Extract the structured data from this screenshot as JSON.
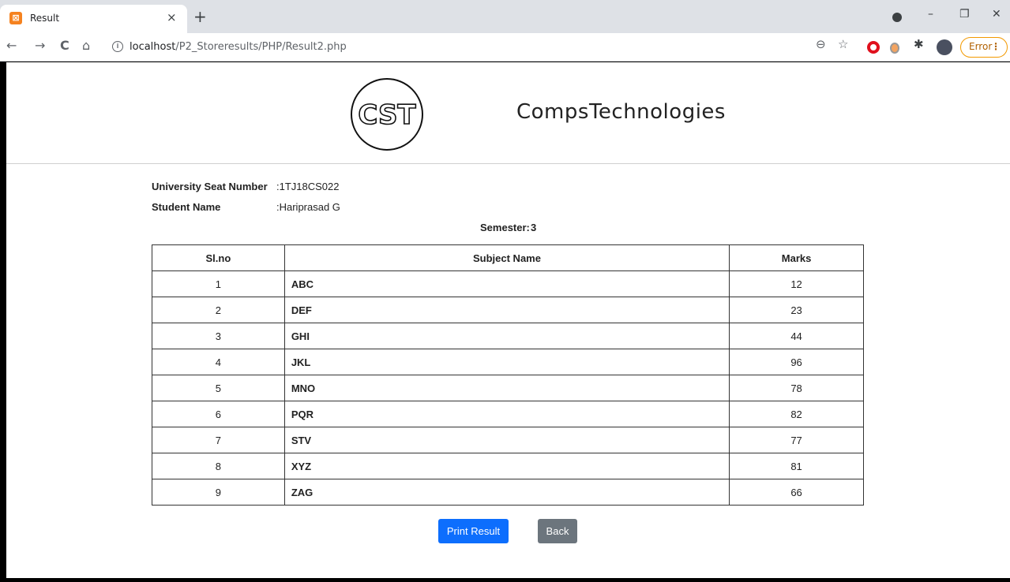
{
  "browser": {
    "tab_title": "Result",
    "tab_close": "×",
    "new_tab": "+",
    "url_host": "localhost",
    "url_path": "/P2_Storeresults/PHP/Result2.php",
    "error_label": "Error",
    "error_menu": "⋮",
    "minimize": "–",
    "restore": "❐",
    "close": "✕",
    "back": "←",
    "forward": "→",
    "reload": "C",
    "home": "⌂",
    "zoom": "⊖",
    "star": "☆",
    "info": "i"
  },
  "brand": {
    "logo_text": "CST",
    "name": "CompsTechnologies"
  },
  "student": {
    "usn_label": "University Seat Number",
    "usn_value": ":1TJ18CS022",
    "name_label": "Student Name",
    "name_value": ":Hariprasad G",
    "semester_label": "Semester:",
    "semester_value": "3"
  },
  "table": {
    "headers": [
      "Sl.no",
      "Subject Name",
      "Marks"
    ],
    "rows": [
      [
        "1",
        "ABC",
        "12"
      ],
      [
        "2",
        "DEF",
        "23"
      ],
      [
        "3",
        "GHI",
        "44"
      ],
      [
        "4",
        "JKL",
        "96"
      ],
      [
        "5",
        "MNO",
        "78"
      ],
      [
        "6",
        "PQR",
        "82"
      ],
      [
        "7",
        "STV",
        "77"
      ],
      [
        "8",
        "XYZ",
        "81"
      ],
      [
        "9",
        "ZAG",
        "66"
      ]
    ]
  },
  "actions": {
    "print_label": "Print Result",
    "back_label": "Back"
  },
  "colors": {
    "print_button": "#0d6efd",
    "back_button": "#6c757d",
    "error_outline": "#f29900"
  }
}
